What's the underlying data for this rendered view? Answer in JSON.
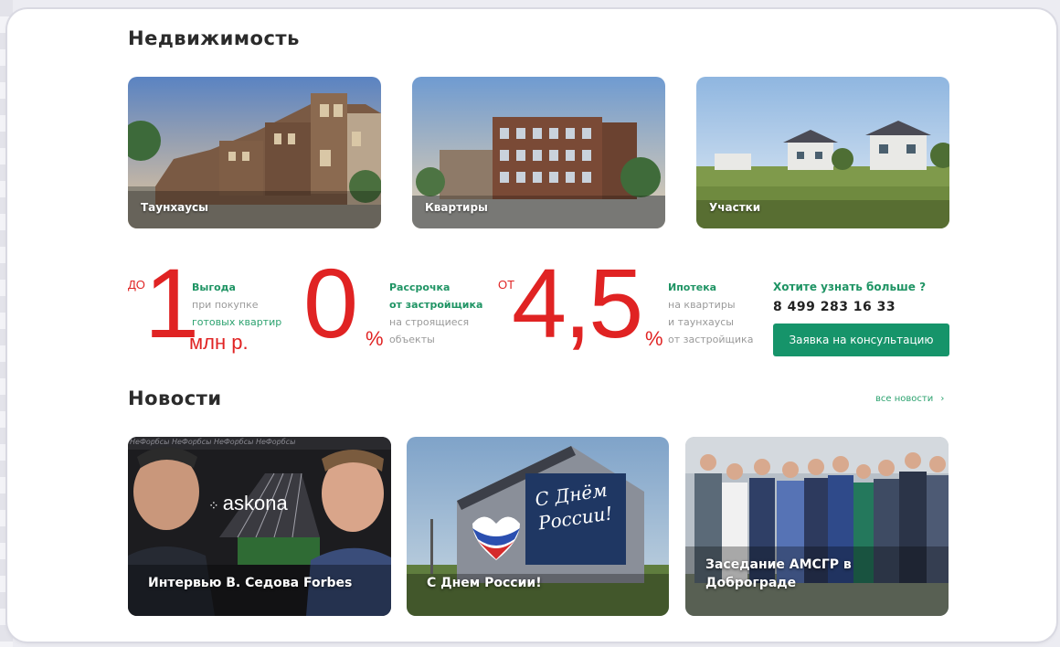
{
  "realty": {
    "title": "Недвижимость",
    "tiles": [
      {
        "label": "Таунхаусы"
      },
      {
        "label": "Квартиры"
      },
      {
        "label": "Участки"
      }
    ]
  },
  "promo": {
    "benefit": {
      "prefix": "ДО",
      "number": "1",
      "unit": "млн р.",
      "heading": "Выгода",
      "line1": "при покупке",
      "line2": "готовых квартир"
    },
    "installment": {
      "number": "0",
      "percent": "%",
      "heading": "Рассрочка",
      "line1": "от застройщика",
      "line2": "на строящиеся",
      "line3": "объекты"
    },
    "mortgage": {
      "prefix": "ОТ",
      "number": "4,5",
      "percent": "%",
      "heading": "Ипотека",
      "line1": "на квартиры",
      "line2": "и таунхаусы",
      "line3": "от застройщика"
    },
    "contact": {
      "heading": "Хотите узнать больше ?",
      "phone": "8 499 283 16 33",
      "button": "Заявка на консультацию"
    }
  },
  "news": {
    "title": "Новости",
    "all_link": "все новости",
    "items": [
      {
        "title": "Интервью В. Седова Forbes",
        "brand": "askona",
        "banner": "НеФорбсы НеФорбсы НеФорбсы НеФорбсы"
      },
      {
        "title": "С Днем России!",
        "poster_line1": "С Днём",
        "poster_line2": "России!"
      },
      {
        "title_line1": "Заседание АМСГР в",
        "title_line2": "Доброграде"
      }
    ]
  },
  "colors": {
    "accent_red": "#e02323",
    "accent_green": "#16946a",
    "text_dark": "#2b2b2b"
  }
}
